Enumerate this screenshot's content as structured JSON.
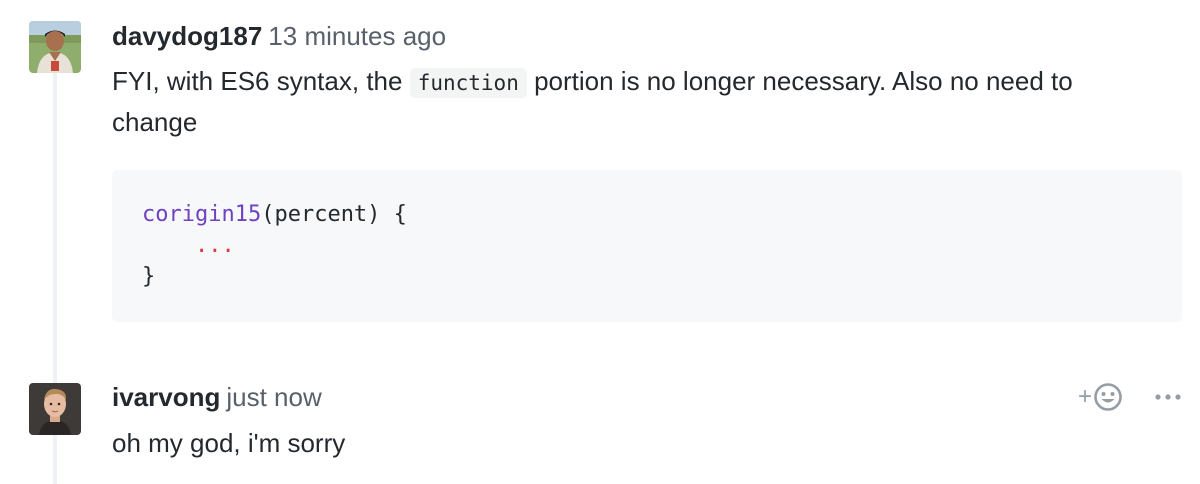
{
  "comments": [
    {
      "author": "davydog187",
      "timestamp": "13 minutes ago",
      "body_before": "FYI, with ES6 syntax, the ",
      "body_code": "function",
      "body_after": " portion is no longer necessary. Also no need to change",
      "code_block": {
        "line1_fn": "corigin15",
        "line1_rest": "(percent) {",
        "line2_indent": "    ",
        "line2_ellipsis": "...",
        "line3": "}"
      }
    },
    {
      "author": "ivarvong",
      "timestamp": "just now",
      "body": "oh my god, i'm sorry"
    }
  ],
  "actions": {
    "reaction_plus": "+",
    "reaction_icon": "smiley-icon",
    "more_icon": "kebab-horizontal-icon"
  },
  "colors": {
    "function_name": "#6f42c1",
    "ellipsis": "#d73a49",
    "muted": "#586069",
    "icon": "#959da5"
  }
}
